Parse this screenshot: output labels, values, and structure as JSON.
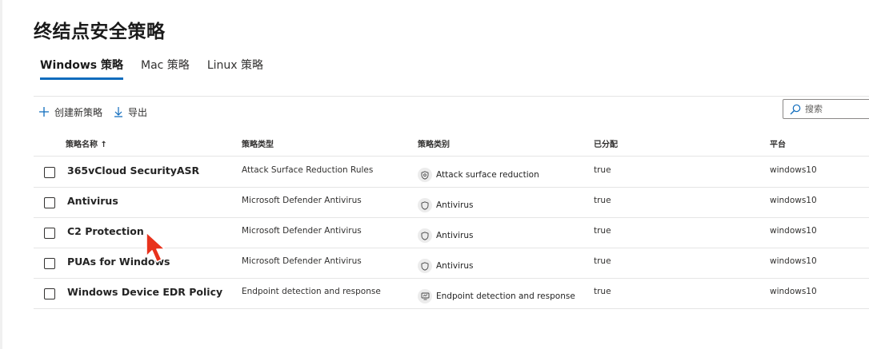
{
  "page": {
    "title": "终结点安全策略"
  },
  "tabs": [
    {
      "label": "Windows 策略",
      "active": true
    },
    {
      "label": "Mac 策略",
      "active": false
    },
    {
      "label": "Linux 策略",
      "active": false
    }
  ],
  "toolbar": {
    "create_label": "创建新策略",
    "export_label": "导出",
    "create_icon": "plus-icon",
    "export_icon": "download-arrow-icon"
  },
  "search": {
    "placeholder": "搜索",
    "icon": "search-icon"
  },
  "table": {
    "columns": [
      "策略名称 ↑",
      "策略类型",
      "策略类别",
      "已分配",
      "平台"
    ],
    "rows": [
      {
        "name": "365vCloud SecurityASR",
        "type": "Attack Surface Reduction Rules",
        "category": "Attack surface reduction",
        "category_icon": "asr-shield-icon",
        "assigned": "true",
        "platform": "windows10"
      },
      {
        "name": "Antivirus",
        "type": "Microsoft Defender Antivirus",
        "category": "Antivirus",
        "category_icon": "shield-icon",
        "assigned": "true",
        "platform": "windows10"
      },
      {
        "name": "C2 Protection",
        "type": "Microsoft Defender Antivirus",
        "category": "Antivirus",
        "category_icon": "shield-icon",
        "assigned": "true",
        "platform": "windows10"
      },
      {
        "name": "PUAs for Windows",
        "type": "Microsoft Defender Antivirus",
        "category": "Antivirus",
        "category_icon": "shield-icon",
        "assigned": "true",
        "platform": "windows10"
      },
      {
        "name": "Windows Device EDR Policy",
        "type": "Endpoint detection and response",
        "category": "Endpoint detection and response",
        "category_icon": "edr-device-icon",
        "assigned": "true",
        "platform": "windows10"
      }
    ]
  },
  "colors": {
    "accent": "#0f6cbd",
    "cursor": "#e8321c"
  }
}
